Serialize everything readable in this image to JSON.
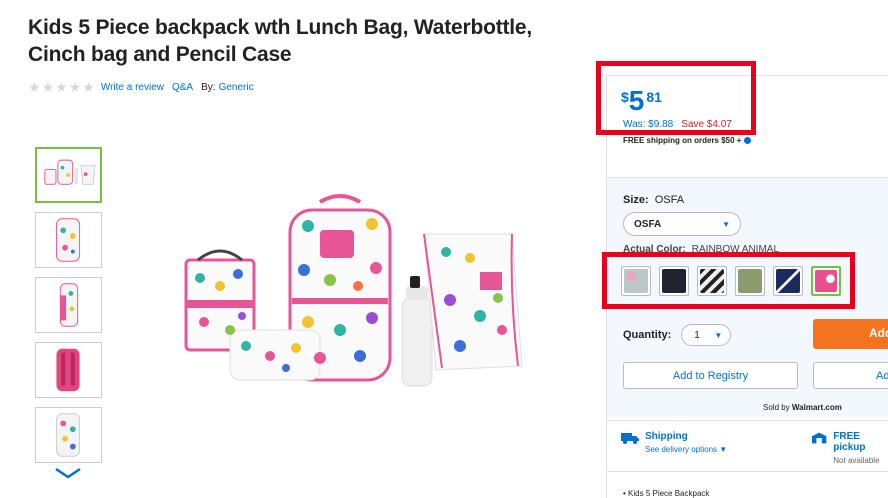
{
  "product": {
    "title": "Kids 5 Piece backpack wth Lunch Bag, Waterbottle, Cinch bag and Pencil Case",
    "write_review": "Write a review",
    "qa": "Q&A",
    "by_label": "By:",
    "brand": "Generic",
    "rating": 0,
    "stars": [
      "★",
      "★",
      "★",
      "★",
      "★"
    ]
  },
  "thumbnails": [
    "set",
    "backpack-front",
    "backpack-side",
    "backpack-back",
    "backpack-open"
  ],
  "price": {
    "currency": "$",
    "dollars": "5",
    "cents": "81",
    "was": "Was: $9.88",
    "save": "Save $4.07",
    "shipping_note": "FREE shipping on orders $50 +"
  },
  "options": {
    "size_label": "Size:",
    "size_value": "OSFA",
    "size_selected": "OSFA",
    "color_label": "Actual Color:",
    "color_value": "RAINBOW ANIMAL",
    "swatch_names": [
      "gray-pattern",
      "black",
      "zebra",
      "olive-animal",
      "navy-stripe",
      "rainbow-animal"
    ],
    "swatch_colors": [
      "#b9c7c6",
      "#1f2430",
      "#555555",
      "#8c9a6c",
      "#1c2a5e",
      "#ea4f8d"
    ],
    "selected_swatch": 5
  },
  "purchase": {
    "quantity_label": "Quantity:",
    "quantity_value": "1",
    "add_to_cart": "Add",
    "add_to_registry": "Add to Registry",
    "add_to_list": "Add",
    "sold_by_prefix": "Sold by",
    "sold_by": "Walmart.com"
  },
  "fulfillment": {
    "shipping_title": "Shipping",
    "shipping_sub": "See delivery options",
    "pickup_title": "FREE pickup",
    "pickup_sub": "Not available"
  },
  "details": {
    "bullet1": "Kids 5 Piece Backpack"
  },
  "colors": {
    "link_blue": "#0071ce",
    "sale_red": "#de1c24",
    "cart_orange": "#f47321",
    "selected_green": "#76c043",
    "highlight_red": "#e8001c"
  }
}
